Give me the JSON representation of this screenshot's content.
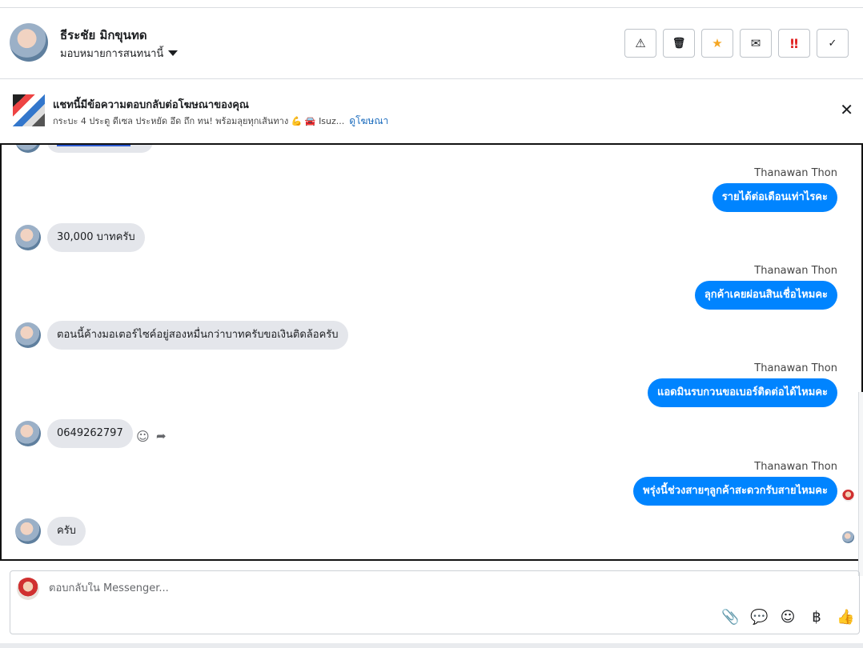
{
  "header": {
    "contact_name": "ธีระชัย มิกขุนทด",
    "assign_label": "มอบหมายการสนทนานี้",
    "actions": [
      {
        "name": "report-button",
        "glyph": "⚠"
      },
      {
        "name": "delete-button",
        "glyph": "🗑"
      },
      {
        "name": "star-button",
        "glyph": "★"
      },
      {
        "name": "mark-unread-button",
        "glyph": "✉"
      },
      {
        "name": "important-button",
        "glyph": "‼"
      },
      {
        "name": "done-button",
        "glyph": "✓"
      }
    ]
  },
  "banner": {
    "title": "แชทนี้มีข้อความตอบกลับต่อโฆษณาของคุณ",
    "subtitle": "กระบะ 4 ประตู ดีเซล ประหยัด อึด ถึก ทน! พร้อมลุยทุกเส้นทาง 💪 🚘 Isuz...",
    "link": "ดูโฆษณา",
    "close": "✕"
  },
  "messages": [
    {
      "type": "out",
      "sender": "Thanawan Thon",
      "text": "รายได้ต่อเดือนเท่าไรคะ"
    },
    {
      "type": "in",
      "text": "30,000 บาทครับ"
    },
    {
      "type": "out",
      "sender": "Thanawan Thon",
      "text": "ลุกค้าเคยผ่อนสินเชื่อไหมคะ"
    },
    {
      "type": "in",
      "text": "ตอนนี้ค้างมอเตอร์ไซค์อยู่สองหมื่นกว่าบาทครับขอเงินติดล้อครับ"
    },
    {
      "type": "out",
      "sender": "Thanawan Thon",
      "text": "แอดมินรบกวนขอเบอร์ติดต่อได้ไหมคะ"
    },
    {
      "type": "in",
      "text": "0649262797"
    },
    {
      "type": "out",
      "sender": "Thanawan Thon",
      "text": "พรุ่งนี้ช่วงสายๆลูกค้าสะดวกรับสายไหมคะ"
    },
    {
      "type": "in",
      "text": "ครับ"
    }
  ],
  "reactions": {
    "emoji": "☺",
    "reply": "➦"
  },
  "composer": {
    "placeholder": "ตอบกลับใน Messenger...",
    "tools": [
      {
        "name": "attach-icon",
        "glyph": "📎"
      },
      {
        "name": "saved-reply-icon",
        "glyph": "💬"
      },
      {
        "name": "emoji-icon",
        "glyph": "☺"
      },
      {
        "name": "payment-icon",
        "glyph": "฿"
      },
      {
        "name": "like-icon",
        "glyph": "👍"
      }
    ]
  },
  "colors": {
    "outgoing": "#0084ff",
    "incoming": "#e4e6eb",
    "star": "#f5a623",
    "important": "#e02020",
    "link": "#1a6bbd"
  }
}
